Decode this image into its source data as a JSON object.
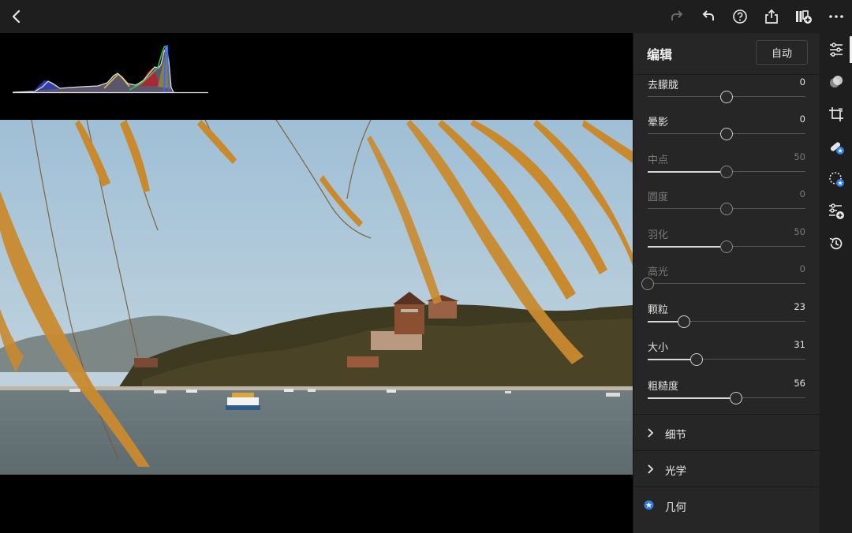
{
  "topbar": {
    "back_icon": "chevron-left-icon",
    "redo_icon": "redo-icon",
    "undo_icon": "undo-icon",
    "help_icon": "help-circle-icon",
    "share_icon": "share-icon",
    "add_preset_icon": "add-to-album-icon",
    "more_icon": "more-icon"
  },
  "canvas": {
    "histogram_icon": "histogram",
    "photo_subject": "photo"
  },
  "panel": {
    "title": "编辑",
    "auto_label": "自动",
    "sliders": [
      {
        "label": "去朦胧",
        "value": "0",
        "level": 0.5,
        "state": "active",
        "bipolar": true
      },
      {
        "label": "晕影",
        "value": "0",
        "level": 0.5,
        "state": "active",
        "bipolar": true
      },
      {
        "label": "中点",
        "value": "50",
        "level": 0.5,
        "state": "disabled",
        "bipolar": false
      },
      {
        "label": "圆度",
        "value": "0",
        "level": 0.5,
        "state": "disabled",
        "bipolar": true
      },
      {
        "label": "羽化",
        "value": "50",
        "level": 0.5,
        "state": "disabled",
        "bipolar": false
      },
      {
        "label": "高光",
        "value": "0",
        "level": 0.0,
        "state": "disabled",
        "bipolar": false
      },
      {
        "label": "颗粒",
        "value": "23",
        "level": 0.23,
        "state": "active",
        "bipolar": false
      },
      {
        "label": "大小",
        "value": "31",
        "level": 0.31,
        "state": "active",
        "bipolar": false
      },
      {
        "label": "粗糙度",
        "value": "56",
        "level": 0.56,
        "state": "active",
        "bipolar": false
      }
    ],
    "sections": [
      {
        "label": "细节",
        "icon": "chevron-right-icon"
      },
      {
        "label": "光学",
        "icon": "chevron-right-icon"
      },
      {
        "label": "几何",
        "icon": "premium-star-badge-icon"
      }
    ]
  },
  "rail": {
    "items": [
      {
        "icon": "adjust-sliders-icon",
        "active": true
      },
      {
        "icon": "presets-icon",
        "active": false
      },
      {
        "icon": "crop-icon",
        "active": false
      },
      {
        "icon": "healing-brush-icon",
        "active": false
      },
      {
        "icon": "masking-icon",
        "active": false
      },
      {
        "icon": "add-preset-icon",
        "active": false
      },
      {
        "icon": "history-icon",
        "active": false
      }
    ]
  },
  "colors": {
    "panel_bg": "#262626",
    "topbar_bg": "#1e1e1e",
    "badge_blue": "#2f7de1"
  }
}
